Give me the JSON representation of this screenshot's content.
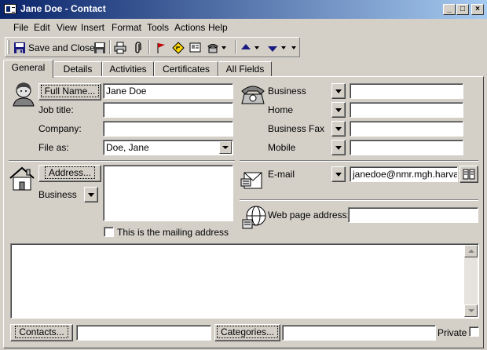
{
  "window": {
    "title": "Jane Doe - Contact",
    "minimize": "_",
    "maximize": "□",
    "close": "×"
  },
  "menu": [
    "File",
    "Edit",
    "View",
    "Insert",
    "Format",
    "Tools",
    "Actions",
    "Help"
  ],
  "toolbar": {
    "save_close": "Save and Close"
  },
  "tabs": [
    "General",
    "Details",
    "Activities",
    "Certificates",
    "All Fields"
  ],
  "general": {
    "full_name_button": "Full Name...",
    "full_name_value": "Jane Doe",
    "job_title_label": "Job title:",
    "job_title_value": "",
    "company_label": "Company:",
    "company_value": "",
    "file_as_label": "File as:",
    "file_as_value": "Doe, Jane",
    "address_button": "Address...",
    "address_type": "Business",
    "address_value": "",
    "mailing_label": "This is the mailing address",
    "phones": [
      {
        "label": "Business",
        "value": ""
      },
      {
        "label": "Home",
        "value": ""
      },
      {
        "label": "Business Fax",
        "value": ""
      },
      {
        "label": "Mobile",
        "value": ""
      }
    ],
    "email_label": "E-mail",
    "email_value": "janedoe@nmr.mgh.harvard.edu",
    "web_label": "Web page address:",
    "web_value": "",
    "notes_value": "",
    "contacts_button": "Contacts...",
    "contacts_value": "",
    "categories_button": "Categories...",
    "categories_value": "",
    "private_label": "Private"
  }
}
